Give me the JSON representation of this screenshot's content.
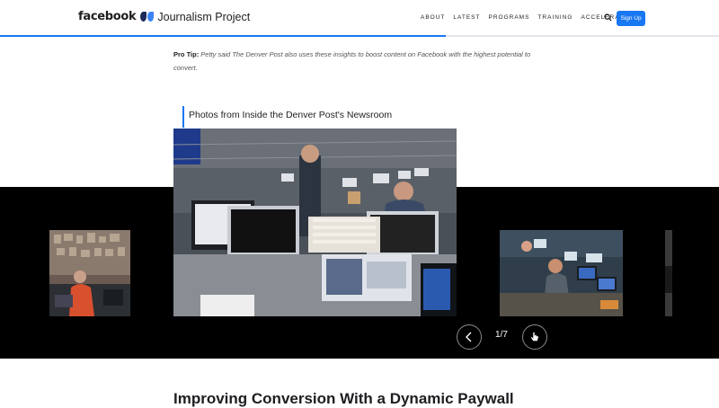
{
  "header": {
    "logo_brand": "facebook",
    "logo_product": "Journalism Project",
    "nav": [
      "ABOUT",
      "LATEST",
      "PROGRAMS",
      "TRAINING",
      "ACCELERATOR"
    ],
    "signup_label": "Sign Up",
    "accent": "#1877f2",
    "read_progress": 0.62
  },
  "protip": {
    "label": "Pro Tip:",
    "text": "Petty said The Denver Post also uses these insights to boost content on Facebook with the highest potential to convert."
  },
  "gallery": {
    "title": "Photos from Inside the Denver Post's Newsroom",
    "counter": "1/7"
  },
  "section": {
    "heading": "Improving Conversion With a Dynamic Paywall"
  }
}
